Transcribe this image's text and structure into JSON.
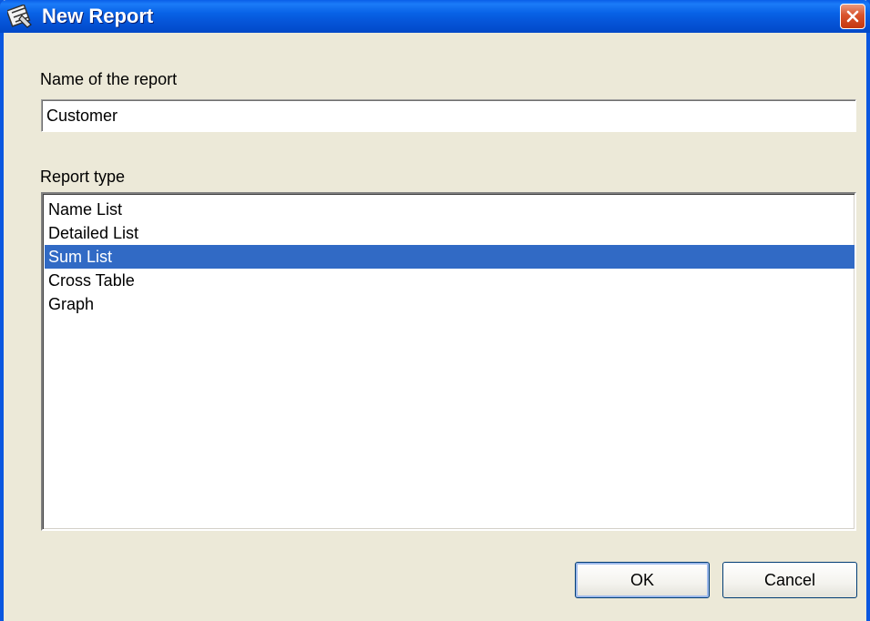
{
  "window": {
    "title": "New Report",
    "icon": "report-wizard-icon",
    "close_icon": "close-icon"
  },
  "form": {
    "name_label": "Name of the report",
    "name_value": "Customer",
    "type_label": "Report type",
    "report_types": [
      "Name List",
      "Detailed List",
      "Sum List",
      "Cross Table",
      "Graph"
    ],
    "selected_type": "Sum List"
  },
  "buttons": {
    "ok": "OK",
    "cancel": "Cancel"
  },
  "colors": {
    "titlebar": "#0553D6",
    "selection": "#316AC5",
    "dialog_bg": "#ECE9D8"
  }
}
